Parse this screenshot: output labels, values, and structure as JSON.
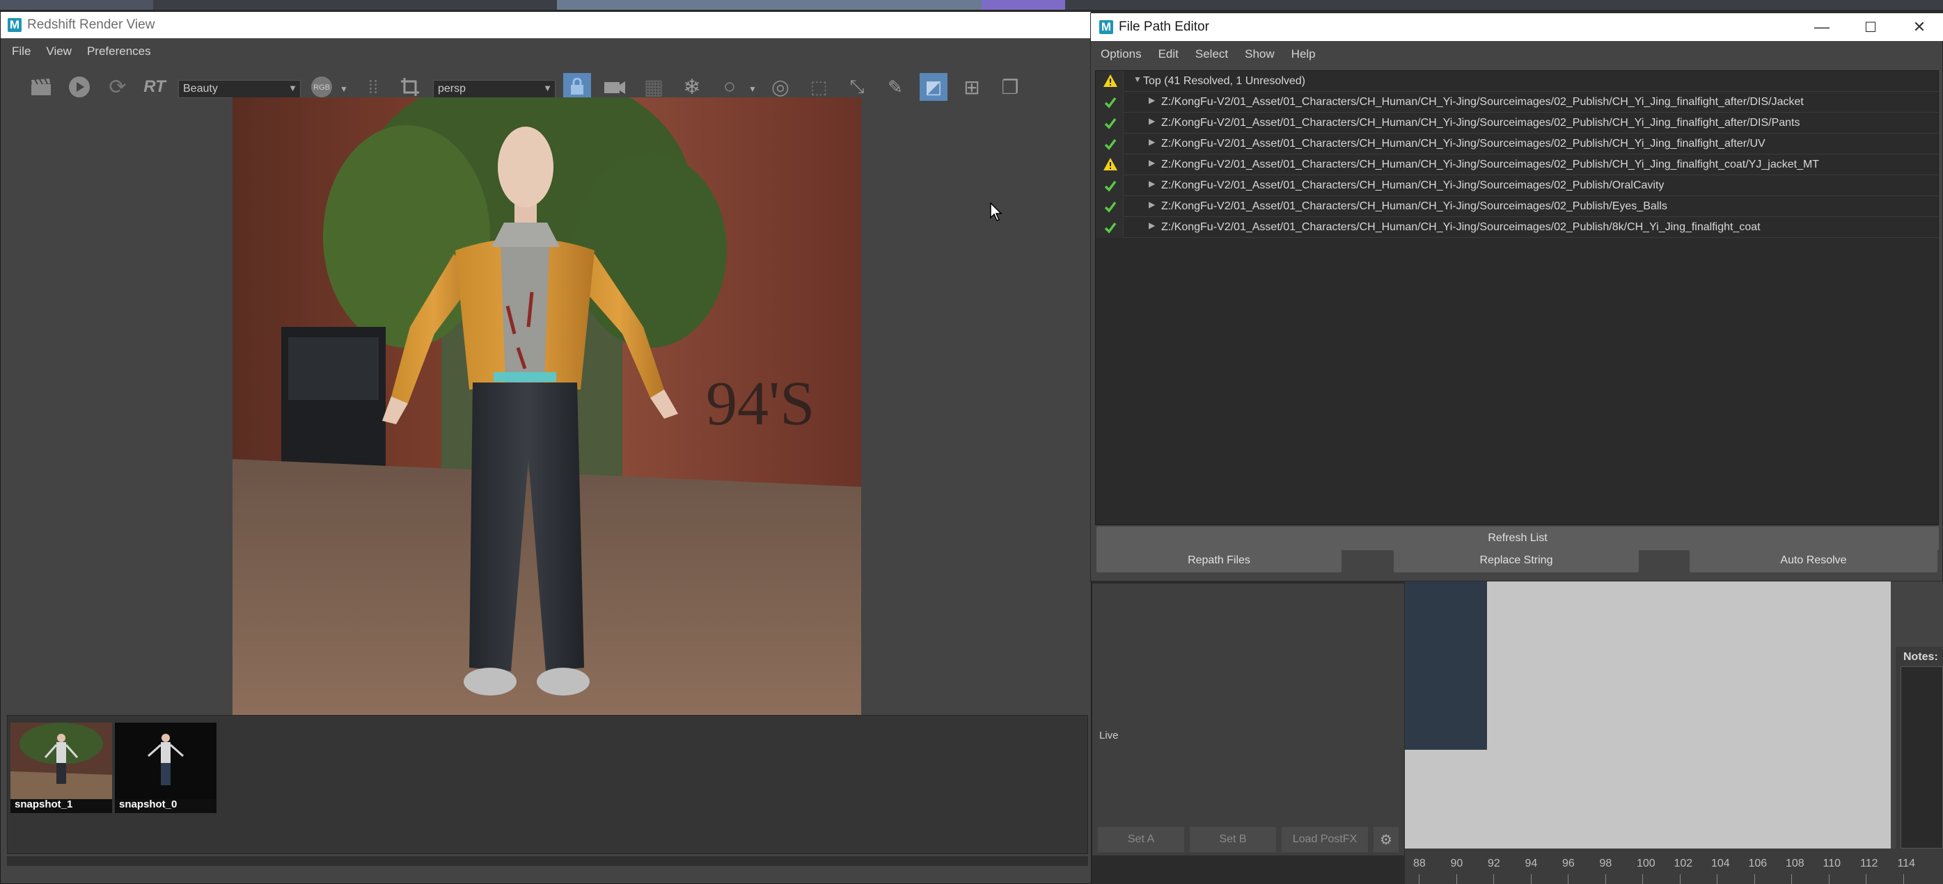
{
  "colors": {
    "accent": "#5a88b8",
    "ok": "#59c945",
    "warn": "#f2d31b",
    "maya_logo": "#1f95b5"
  },
  "render_view": {
    "title": "Redshift Render View",
    "menu": [
      "File",
      "View",
      "Preferences"
    ],
    "aov_combo": "Beauty",
    "channel_label": "RGB",
    "camera_combo": "persp",
    "rt_label": "RT",
    "snapshots": [
      {
        "label": "snapshot_1"
      },
      {
        "label": "snapshot_0"
      }
    ]
  },
  "file_path_editor": {
    "title": "File Path Editor",
    "menu": [
      "Options",
      "Edit",
      "Select",
      "Show",
      "Help"
    ],
    "top_row": {
      "label": "Top (41 Resolved, 1 Unresolved)",
      "status": "warning"
    },
    "paths": [
      {
        "path": "Z:/KongFu-V2/01_Asset/01_Characters/CH_Human/CH_Yi-Jing/Sourceimages/02_Publish/CH_Yi_Jing_finalfight_after/DIS/Jacket",
        "status": "ok"
      },
      {
        "path": "Z:/KongFu-V2/01_Asset/01_Characters/CH_Human/CH_Yi-Jing/Sourceimages/02_Publish/CH_Yi_Jing_finalfight_after/DIS/Pants",
        "status": "ok"
      },
      {
        "path": "Z:/KongFu-V2/01_Asset/01_Characters/CH_Human/CH_Yi-Jing/Sourceimages/02_Publish/CH_Yi_Jing_finalfight_after/UV",
        "status": "ok"
      },
      {
        "path": "Z:/KongFu-V2/01_Asset/01_Characters/CH_Human/CH_Yi-Jing/Sourceimages/02_Publish/CH_Yi_Jing_finalfight_coat/YJ_jacket_MT",
        "status": "warning"
      },
      {
        "path": "Z:/KongFu-V2/01_Asset/01_Characters/CH_Human/CH_Yi-Jing/Sourceimages/02_Publish/OralCavity",
        "status": "ok"
      },
      {
        "path": "Z:/KongFu-V2/01_Asset/01_Characters/CH_Human/CH_Yi-Jing/Sourceimages/02_Publish/Eyes_Balls",
        "status": "ok"
      },
      {
        "path": "Z:/KongFu-V2/01_Asset/01_Characters/CH_Human/CH_Yi-Jing/Sourceimages/02_Publish/8k/CH_Yi_Jing_finalfight_coat",
        "status": "ok"
      }
    ],
    "buttons": {
      "refresh": "Refresh List",
      "repath": "Repath Files",
      "replace": "Replace String",
      "auto": "Auto Resolve"
    }
  },
  "postfx": {
    "live_label": "Live",
    "set_a": "Set A",
    "set_b": "Set B",
    "load": "Load PostFX"
  },
  "notes_label": "Notes:",
  "timeline_ticks": [
    "88",
    "90",
    "92",
    "94",
    "96",
    "98",
    "100",
    "102",
    "104",
    "106",
    "108",
    "110",
    "112",
    "114"
  ]
}
